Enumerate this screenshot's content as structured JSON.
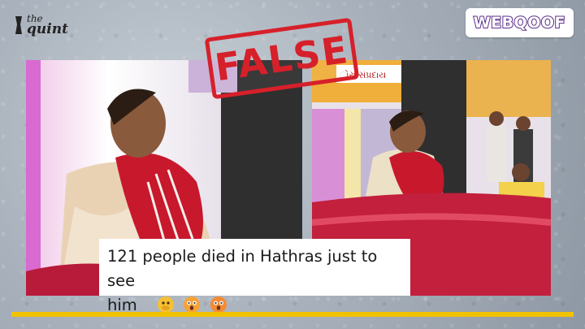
{
  "brand_left": {
    "line1": "the",
    "line2": "quint"
  },
  "brand_right": {
    "label": "WEBQOOF"
  },
  "verdict": {
    "label": "FALSE",
    "color": "#d6202a"
  },
  "caption": {
    "text_line1": "121 people died in Hathras just to see",
    "text_line2": "him"
  },
  "emojis": [
    "face-with-hand-over-mouth-icon",
    "astonished-face-icon",
    "astonished-face-icon"
  ],
  "banner": {
    "text": "ોરા સંપ્રદાય"
  },
  "colors": {
    "accent_bar": "#f2c200",
    "webqoof_purple": "#5b2d8a",
    "stamp_red": "#d6202a"
  }
}
